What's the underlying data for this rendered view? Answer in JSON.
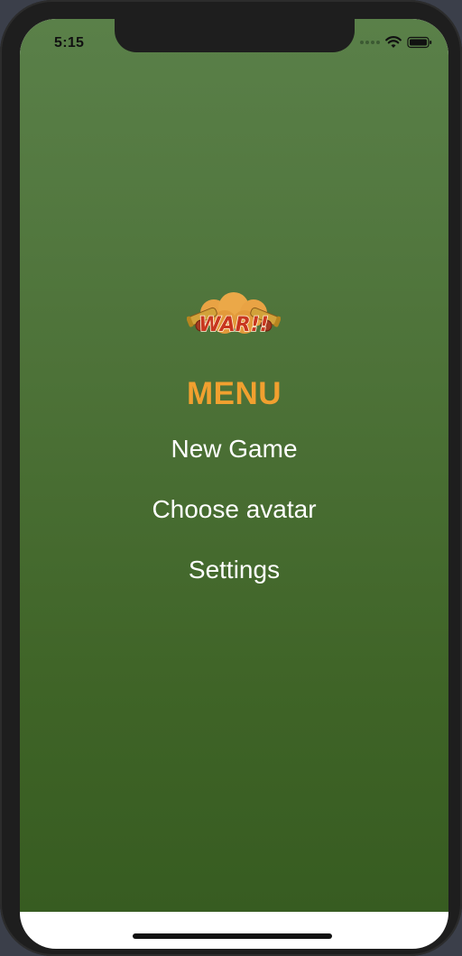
{
  "status_bar": {
    "time": "5:15",
    "wifi_icon": "wifi-icon",
    "battery_icon": "battery-icon"
  },
  "logo": {
    "text": "WAR!!",
    "icon": "war-logo-with-cannons"
  },
  "menu": {
    "title": "MENU",
    "items": [
      {
        "label": "New Game"
      },
      {
        "label": "Choose avatar"
      },
      {
        "label": "Settings"
      }
    ]
  },
  "colors": {
    "background_top": "#5a8049",
    "background_bottom": "#375c21",
    "title": "#f1a02f",
    "menu_text": "#ffffff"
  }
}
